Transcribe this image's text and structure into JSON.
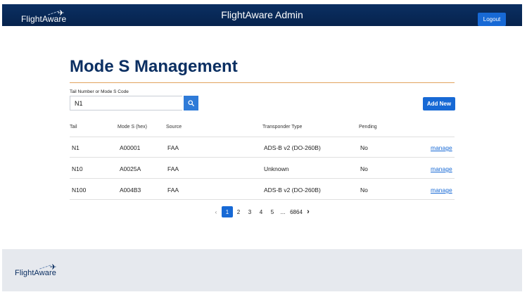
{
  "header": {
    "logo_text": "FlightAware",
    "title": "FlightAware Admin",
    "logout_label": "Logout"
  },
  "main": {
    "title": "Mode S Management",
    "search": {
      "label": "Tail Number or Mode S Code",
      "value": "N1"
    },
    "add_new_label": "Add New",
    "columns": [
      "Tail",
      "Mode S (hex)",
      "Source",
      "Transponder Type",
      "Pending"
    ],
    "rows": [
      {
        "tail": "N1",
        "mode_s": "A00001",
        "source": "FAA",
        "transponder": "ADS-B v2 (DO-260B)",
        "pending": "No",
        "action": "manage"
      },
      {
        "tail": "N10",
        "mode_s": "A0025A",
        "source": "FAA",
        "transponder": "Unknown",
        "pending": "No",
        "action": "manage"
      },
      {
        "tail": "N100",
        "mode_s": "A004B3",
        "source": "FAA",
        "transponder": "ADS-B v2 (DO-260B)",
        "pending": "No",
        "action": "manage"
      }
    ],
    "pagination": {
      "prev_icon": "‹",
      "pages": [
        "1",
        "2",
        "3",
        "4",
        "5"
      ],
      "ellipsis": "...",
      "last": "6864",
      "next_icon": "›",
      "active_page": "1"
    }
  },
  "footer": {
    "logo_text": "FlightAware"
  },
  "colors": {
    "header_bg": "#06234d",
    "accent_blue": "#1769d5",
    "title_rule": "#e1a35e",
    "footer_bg": "#e6e9ee"
  }
}
